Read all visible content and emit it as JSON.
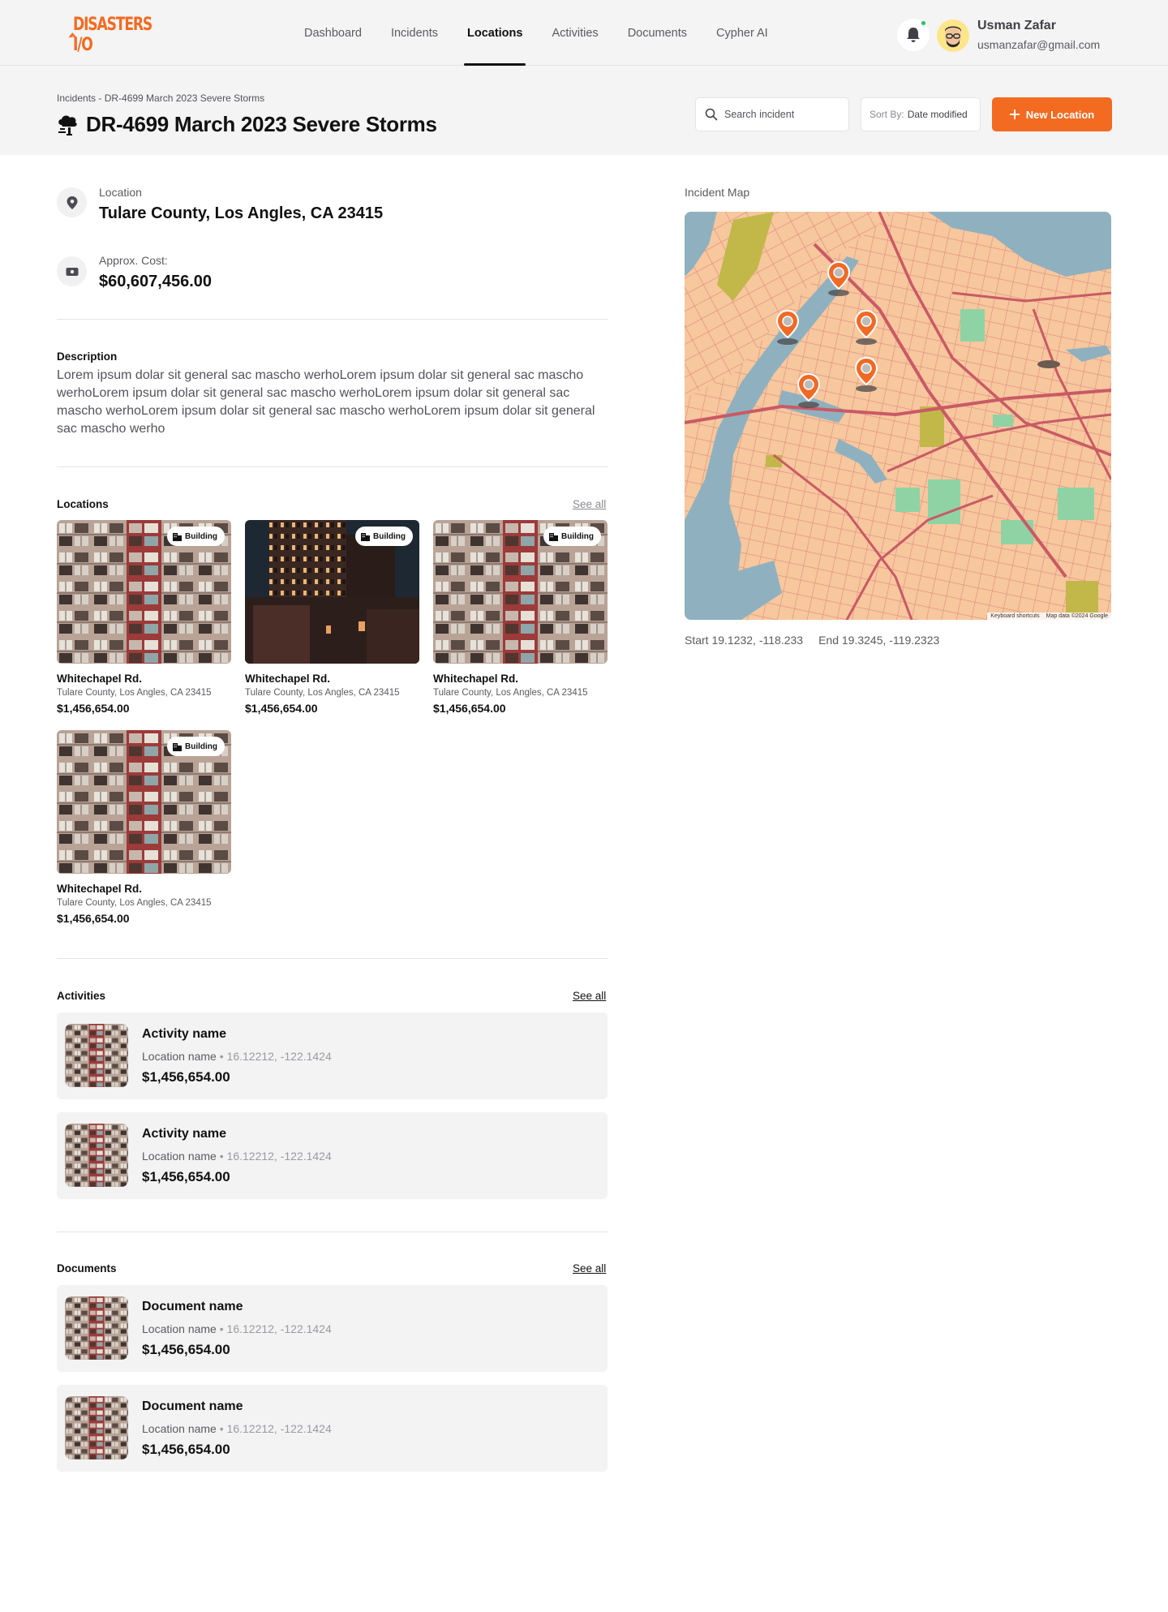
{
  "app": {
    "logo_text": "DISASTERS I/O",
    "nav": [
      {
        "label": "Dashboard"
      },
      {
        "label": "Incidents"
      },
      {
        "label": "Locations"
      },
      {
        "label": "Activities"
      },
      {
        "label": "Documents"
      },
      {
        "label": "Cypher AI"
      }
    ],
    "active_nav": "Locations",
    "user": {
      "name": "Usman Zafar",
      "email": "usmanzafar@gmail.com"
    },
    "accent_color": "#f26b21",
    "status_color": "#22c55e"
  },
  "header": {
    "breadcrumb": "Incidents - DR-4699 March 2023 Severe Storms",
    "title": "DR-4699 March 2023 Severe Storms",
    "title_icon": "storm-cloud-icon",
    "search_placeholder": "Search incident",
    "sort_label": "Sort By:",
    "sort_value": "Date modified",
    "new_button": "New Location"
  },
  "details": {
    "location_label": "Location",
    "location_value": "Tulare County,  Los Angles, CA 23415",
    "cost_label": "Approx. Cost:",
    "cost_value": "$60,607,456.00"
  },
  "description": {
    "title": "Description",
    "text": "Lorem ipsum dolar sit general sac mascho werhoLorem ipsum dolar sit general sac mascho werhoLorem ipsum dolar sit general sac mascho werhoLorem ipsum dolar sit general sac mascho werhoLorem ipsum dolar sit general sac mascho werhoLorem ipsum dolar sit general sac mascho werho"
  },
  "locations": {
    "title": "Locations",
    "see_all": "See all",
    "items": [
      {
        "badge": "Building",
        "name": "Whitechapel Rd.",
        "address": "Tulare County,  Los Angles, CA 23415",
        "cost": "$1,456,654.00",
        "image": "apartment-facade"
      },
      {
        "badge": "Building",
        "name": "Whitechapel Rd.",
        "address": "Tulare County,  Los Angles, CA 23415",
        "cost": "$1,456,654.00",
        "image": "night-towers"
      },
      {
        "badge": "Building",
        "name": "Whitechapel Rd.",
        "address": "Tulare County,  Los Angles, CA 23415",
        "cost": "$1,456,654.00",
        "image": "apartment-facade"
      },
      {
        "badge": "Building",
        "name": "Whitechapel Rd.",
        "address": "Tulare County,  Los Angles, CA 23415",
        "cost": "$1,456,654.00",
        "image": "apartment-facade"
      }
    ]
  },
  "activities": {
    "title": "Activities",
    "see_all": "See all",
    "items": [
      {
        "name": "Activity name",
        "location": "Location name",
        "coords": "16.12212, -122.1424",
        "cost": "$1,456,654.00"
      },
      {
        "name": "Activity name",
        "location": "Location name",
        "coords": "16.12212, -122.1424",
        "cost": "$1,456,654.00"
      }
    ]
  },
  "documents": {
    "title": "Documents",
    "see_all": "See all",
    "items": [
      {
        "name": "Document name",
        "location": "Location name",
        "coords": "16.12212, -122.1424",
        "cost": "$1,456,654.00"
      },
      {
        "name": "Document name",
        "location": "Location name",
        "coords": "16.12212, -122.1424",
        "cost": "$1,456,654.00"
      }
    ]
  },
  "map": {
    "title": "Incident Map",
    "start": "Start 19.1232, -118.233",
    "end": "End 19.3245, -119.2323",
    "credit_shortcuts": "Keyboard shortcuts",
    "credit_data": "Map data ©2024 Google",
    "marker_count": 5
  }
}
